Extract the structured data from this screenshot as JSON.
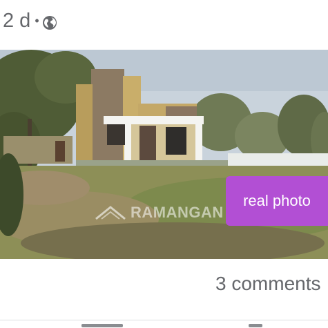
{
  "post": {
    "time_ago": "2 d",
    "separator": "•",
    "audience_icon": "globe-icon"
  },
  "photo": {
    "badge_text": "real photo",
    "badge_color": "#b24fd4",
    "watermark_text": "RAMANGAN"
  },
  "footer": {
    "comments_text": "3 comments"
  }
}
